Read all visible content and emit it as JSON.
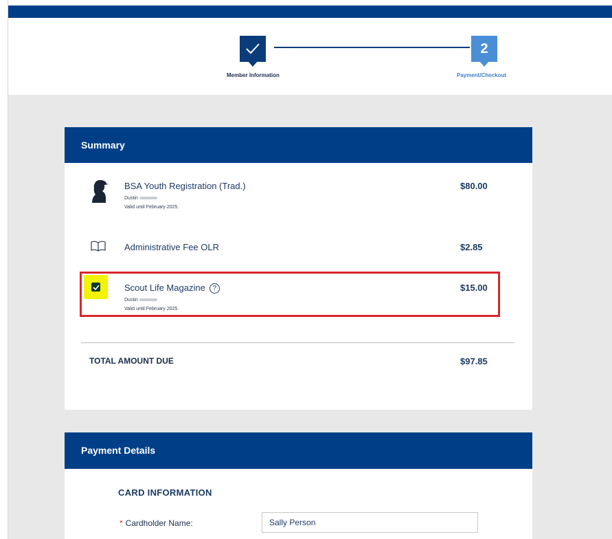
{
  "stepper": {
    "step1": {
      "label": "Member Information",
      "status": "completed",
      "icon": "check-icon"
    },
    "step2": {
      "number": "2",
      "label": "Payment/Checkout",
      "status": "current"
    }
  },
  "summary": {
    "title": "Summary",
    "items": [
      {
        "icon": "scout-silhouette-icon",
        "title": "BSA Youth Registration (Trad.)",
        "member": "Dustin",
        "valid": "Valid until February 2025.",
        "price": "$80.00"
      },
      {
        "icon": "book-icon",
        "title": "Administrative Fee OLR",
        "price": "$2.85"
      },
      {
        "icon": "checkbox-checked",
        "title": "Scout Life Magazine",
        "member": "Dustin",
        "valid": "Valid until February 2025.",
        "price": "$15.00",
        "checked": true
      }
    ],
    "total_label": "TOTAL AMOUNT DUE",
    "total_value": "$97.85"
  },
  "payment": {
    "title": "Payment Details",
    "section": "CARD INFORMATION",
    "cardholder_label": "Cardholder Name:",
    "cardholder_value": "Sally Person"
  },
  "colors": {
    "brand_navy": "#003f87",
    "step_current": "#4a8fd6",
    "highlight_red": "#d9262b",
    "highlight_yellow": "#f2f20a"
  }
}
